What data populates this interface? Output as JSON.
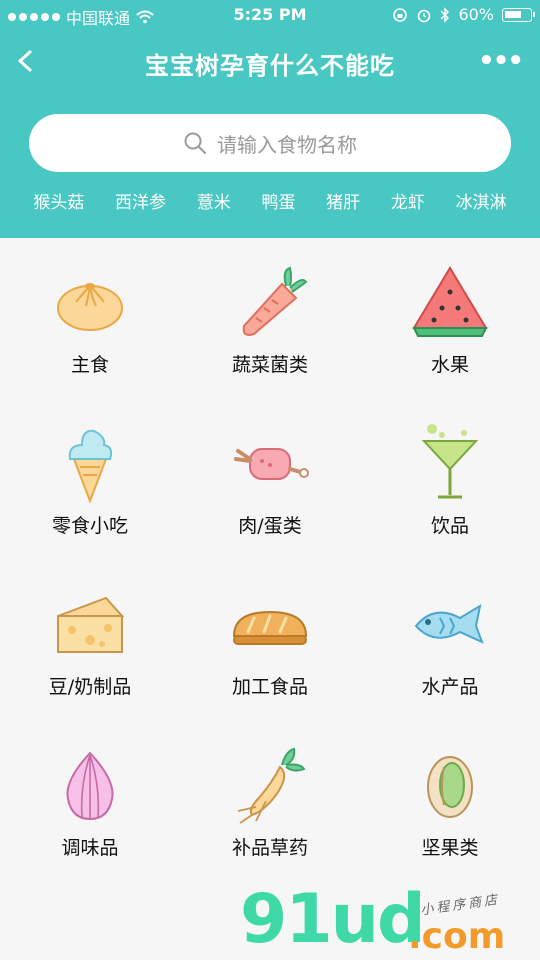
{
  "status_bar": {
    "carrier": "中国联通",
    "time": "5:25 PM",
    "battery": "60%"
  },
  "nav": {
    "title": "宝宝树孕育什么不能吃",
    "more": "•••"
  },
  "search": {
    "placeholder": "请输入食物名称"
  },
  "hot_tags": [
    "猴头菇",
    "西洋参",
    "薏米",
    "鸭蛋",
    "猪肝",
    "龙虾",
    "冰淇淋"
  ],
  "categories": [
    {
      "label": "主食",
      "icon": "bun-icon"
    },
    {
      "label": "蔬菜菌类",
      "icon": "carrot-icon"
    },
    {
      "label": "水果",
      "icon": "watermelon-icon"
    },
    {
      "label": "零食小吃",
      "icon": "ice-cream-icon"
    },
    {
      "label": "肉/蛋类",
      "icon": "meat-icon"
    },
    {
      "label": "饮品",
      "icon": "cocktail-icon"
    },
    {
      "label": "豆/奶制品",
      "icon": "cheese-icon"
    },
    {
      "label": "加工食品",
      "icon": "bread-icon"
    },
    {
      "label": "水产品",
      "icon": "fish-icon"
    },
    {
      "label": "调味品",
      "icon": "onion-icon"
    },
    {
      "label": "补品草药",
      "icon": "ginseng-icon"
    },
    {
      "label": "坚果类",
      "icon": "pistachio-icon"
    }
  ],
  "watermark": {
    "brand": "91ud",
    "domain": ".com",
    "slogan": "小程序商店"
  },
  "colors": {
    "header": "#48c7c3",
    "background": "#f6f6f6"
  }
}
